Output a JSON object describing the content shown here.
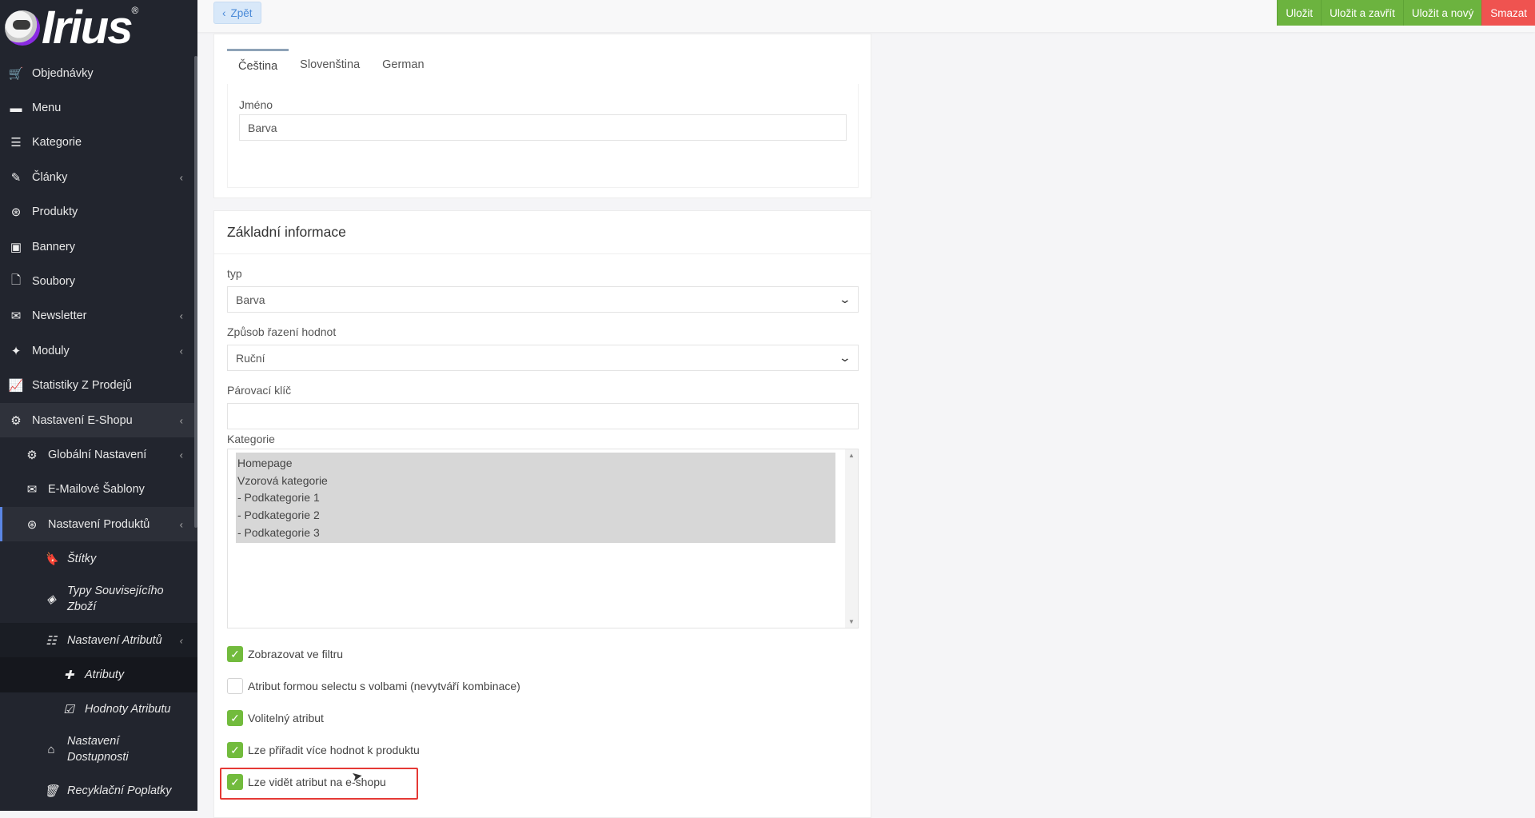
{
  "logo": {
    "text": "Irius",
    "reg": "®"
  },
  "sidebar": {
    "items": [
      {
        "label": "Objednávky",
        "icon": "cart-icon",
        "glyph": "🛒"
      },
      {
        "label": "Menu",
        "icon": "folder-icon",
        "glyph": "▬"
      },
      {
        "label": "Kategorie",
        "icon": "list-icon",
        "glyph": "☰"
      },
      {
        "label": "Články",
        "icon": "pencil-icon",
        "glyph": "✎",
        "chevron": "‹"
      },
      {
        "label": "Produkty",
        "icon": "aperture-icon",
        "glyph": "⊛"
      },
      {
        "label": "Bannery",
        "icon": "image-icon",
        "glyph": "▣"
      },
      {
        "label": "Soubory",
        "icon": "file-icon",
        "glyph": "🗋"
      },
      {
        "label": "Newsletter",
        "icon": "envelope-circle-icon",
        "glyph": "✉",
        "chevron": "‹"
      },
      {
        "label": "Moduly",
        "icon": "puzzle-icon",
        "glyph": "✦",
        "chevron": "‹"
      },
      {
        "label": "Statistiky Z Prodejů",
        "icon": "chart-line-icon",
        "glyph": "📈"
      },
      {
        "label": "Nastavení E-Shopu",
        "icon": "gears-icon",
        "glyph": "⚙",
        "chevron": "‹"
      }
    ],
    "sub": [
      {
        "label": "Globální Nastavení",
        "icon": "gear-icon",
        "glyph": "⚙",
        "chevron": "‹"
      },
      {
        "label": "E-Mailové Šablony",
        "icon": "mail-template-icon",
        "glyph": "✉"
      },
      {
        "label": "Nastavení Produktů",
        "icon": "aperture-icon",
        "glyph": "⊛",
        "chevron": "‹"
      }
    ],
    "sub2": [
      {
        "label": "Štítky",
        "icon": "bookmark-icon",
        "glyph": "🔖"
      },
      {
        "label": "Typy Souvisejícího Zboží",
        "icon": "layers-icon",
        "glyph": "◈"
      },
      {
        "label": "Nastavení Atributů",
        "icon": "sliders-icon",
        "glyph": "☷",
        "chevron": "‹"
      }
    ],
    "sub3": [
      {
        "label": "Atributy",
        "icon": "plus-icon",
        "glyph": "✚"
      },
      {
        "label": "Hodnoty Atributu",
        "icon": "checkbox-icon",
        "glyph": "☑"
      }
    ],
    "sub2b": [
      {
        "label": "Nastavení Dostupnosti",
        "icon": "home-icon",
        "glyph": "⌂"
      },
      {
        "label": "Recyklační Poplatky",
        "icon": "trash-icon",
        "glyph": "🗑"
      }
    ]
  },
  "topbar": {
    "back_label": "Zpět",
    "back_icon": "‹",
    "actions": [
      "Uložit",
      "Uložit a zavřít",
      "Uložit a nový"
    ],
    "delete_label": "Smazat"
  },
  "lang_tabs": [
    "Čeština",
    "Slovenština",
    "German"
  ],
  "name_field": {
    "label": "Jméno",
    "value": "Barva"
  },
  "basic": {
    "title": "Základní informace",
    "type_label": "typ",
    "type_value": "Barva",
    "sort_label": "Způsob řazení hodnot",
    "sort_value": "Ruční",
    "pair_label": "Párovací klíč",
    "pair_value": "",
    "category_label": "Kategorie",
    "categories": [
      "Homepage",
      "Vzorová kategorie",
      "- Podkategorie 1",
      "- Podkategorie 2",
      "- Podkategorie 3"
    ]
  },
  "checks": [
    {
      "label": "Zobrazovat ve filtru",
      "checked": true
    },
    {
      "label": "Atribut formou selectu s volbami (nevytváří kombinace)",
      "checked": false
    },
    {
      "label": "Volitelný atribut",
      "checked": true
    },
    {
      "label": "Lze přiřadit více hodnot k produktu",
      "checked": true
    },
    {
      "label": "Lze vidět atribut na e-shopu",
      "checked": true
    }
  ],
  "colors": {
    "sidebar": "#22252e",
    "accent_green": "#72bb3d",
    "danger": "#ef5350",
    "highlight": "#e53935"
  }
}
